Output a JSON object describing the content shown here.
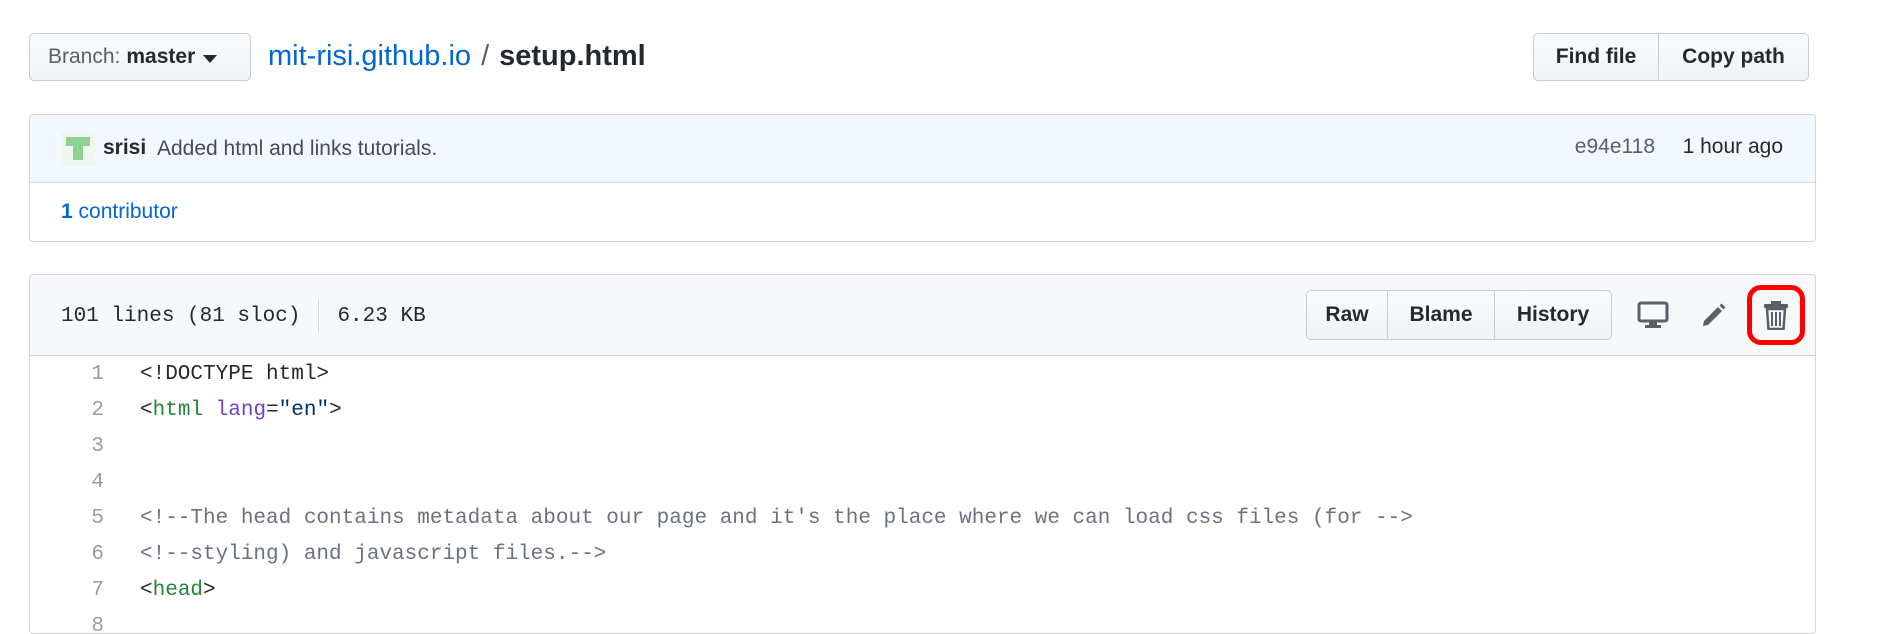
{
  "branch": {
    "label": "Branch:",
    "value": "master"
  },
  "breadcrumb": {
    "repo": "mit-risi.github.io",
    "separator": "/",
    "file": "setup.html"
  },
  "actions": {
    "find_file": "Find file",
    "copy_path": "Copy path"
  },
  "commit": {
    "author": "srisi",
    "message": "Added html and links tutorials.",
    "sha": "e94e118",
    "time": "1 hour ago",
    "contributors_count": "1",
    "contributors_label": "contributor"
  },
  "file": {
    "lines_info": "101 lines (81 sloc)",
    "size": "6.23 KB",
    "buttons": {
      "raw": "Raw",
      "blame": "Blame",
      "history": "History"
    },
    "icons": [
      "desktop-icon",
      "pencil-icon",
      "trash-icon"
    ]
  },
  "code": {
    "lines": [
      {
        "n": "1",
        "parts": [
          {
            "t": "<!DOCTYPE html>",
            "c": "plain"
          }
        ]
      },
      {
        "n": "2",
        "parts": [
          {
            "t": "<",
            "c": "plain"
          },
          {
            "t": "html",
            "c": "tag"
          },
          {
            "t": " ",
            "c": "plain"
          },
          {
            "t": "lang",
            "c": "attr"
          },
          {
            "t": "=",
            "c": "plain"
          },
          {
            "t": "\"en\"",
            "c": "str"
          },
          {
            "t": ">",
            "c": "plain"
          }
        ]
      },
      {
        "n": "3",
        "parts": []
      },
      {
        "n": "4",
        "parts": []
      },
      {
        "n": "5",
        "parts": [
          {
            "t": "<!--The head contains metadata about our page and it's the place where we can load css files (for -->",
            "c": "cmt"
          }
        ]
      },
      {
        "n": "6",
        "parts": [
          {
            "t": "<!--styling) and javascript files.-->",
            "c": "cmt"
          }
        ]
      },
      {
        "n": "7",
        "parts": [
          {
            "t": "<",
            "c": "plain"
          },
          {
            "t": "head",
            "c": "tag"
          },
          {
            "t": ">",
            "c": "plain"
          }
        ]
      },
      {
        "n": "8",
        "parts": []
      }
    ]
  }
}
